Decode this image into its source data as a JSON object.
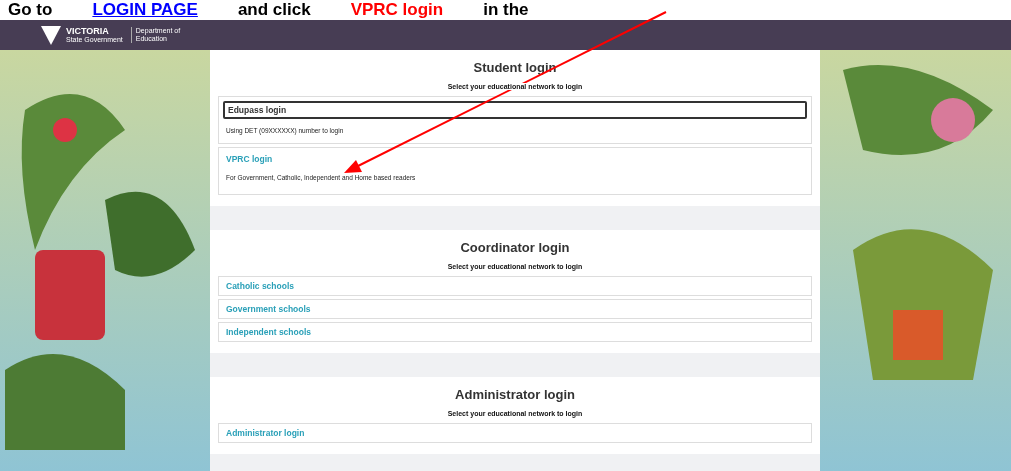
{
  "instruction": {
    "before": "Go to",
    "link": "LOGIN PAGE",
    "middle": "and click",
    "highlight": "VPRC login",
    "after": "in the"
  },
  "header": {
    "logo_word": "VICTORIA",
    "logo_sub": "State Government",
    "department": "Department of Education"
  },
  "sections": [
    {
      "title": "Student login",
      "subtitle": "Select your educational network to login",
      "options": [
        {
          "kind": "detailed",
          "label": "Edupass login",
          "description": "Using DET (09XXXXXX) number to login",
          "selected": true
        },
        {
          "kind": "detailed",
          "label": "VPRC login",
          "description": "For Government, Catholic, Independent and Home based readers",
          "selected": false
        }
      ]
    },
    {
      "title": "Coordinator login",
      "subtitle": "Select your educational network to login",
      "options": [
        {
          "kind": "link",
          "label": "Catholic schools",
          "selected": false
        },
        {
          "kind": "link",
          "label": "Government schools",
          "selected": false
        },
        {
          "kind": "link",
          "label": "Independent schools",
          "selected": false
        }
      ]
    },
    {
      "title": "Administrator login",
      "subtitle": "Select your educational network to login",
      "options": [
        {
          "kind": "link",
          "label": "Administrator login",
          "selected": false
        }
      ]
    }
  ]
}
